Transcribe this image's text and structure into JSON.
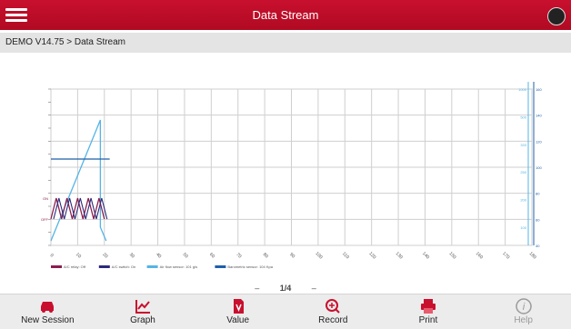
{
  "header": {
    "title": "Data Stream"
  },
  "breadcrumb": "DEMO V14.75 > Data Stream",
  "pager": {
    "prev": "–",
    "current": "1/4",
    "next": "–"
  },
  "toolbar": {
    "buttons": [
      {
        "label": "New Session",
        "icon": "car-icon",
        "enabled": true
      },
      {
        "label": "Graph",
        "icon": "graph-icon",
        "enabled": true
      },
      {
        "label": "Value",
        "icon": "value-icon",
        "enabled": true
      },
      {
        "label": "Record",
        "icon": "record-icon",
        "enabled": true
      },
      {
        "label": "Print",
        "icon": "print-icon",
        "enabled": true
      },
      {
        "label": "Help",
        "icon": "info-icon",
        "enabled": false
      }
    ]
  },
  "colors": {
    "brand": "#c8102e",
    "grid": "#cfcfcf",
    "series_ac_relay": "#8b1e4f",
    "series_ac_switch": "#2a2a7a",
    "series_air_flow": "#55b4e6",
    "series_baro": "#1f5fa8"
  },
  "chart_data": {
    "type": "line",
    "x_ticks": [
      "0",
      "10",
      "20",
      "30",
      "40",
      "50",
      "60",
      "70",
      "80",
      "90",
      "100",
      "110",
      "120",
      "130",
      "140",
      "150",
      "160",
      "170",
      "180"
    ],
    "right_axis_ticks_inner": [
      "1000",
      "500",
      "333",
      "250",
      "200",
      "100"
    ],
    "right_axis_ticks_outer": [
      "160",
      "140",
      "120",
      "100",
      "80",
      "60",
      "40"
    ],
    "left_axis_labels": [
      "ON",
      "OFF"
    ],
    "series": [
      {
        "name": "A/C relay: Off"
      },
      {
        "name": "A/C switch: On"
      },
      {
        "name": "Air flow sensor: 101 g/s"
      },
      {
        "name": "Barometric sensor: 104 Kpa"
      }
    ]
  }
}
